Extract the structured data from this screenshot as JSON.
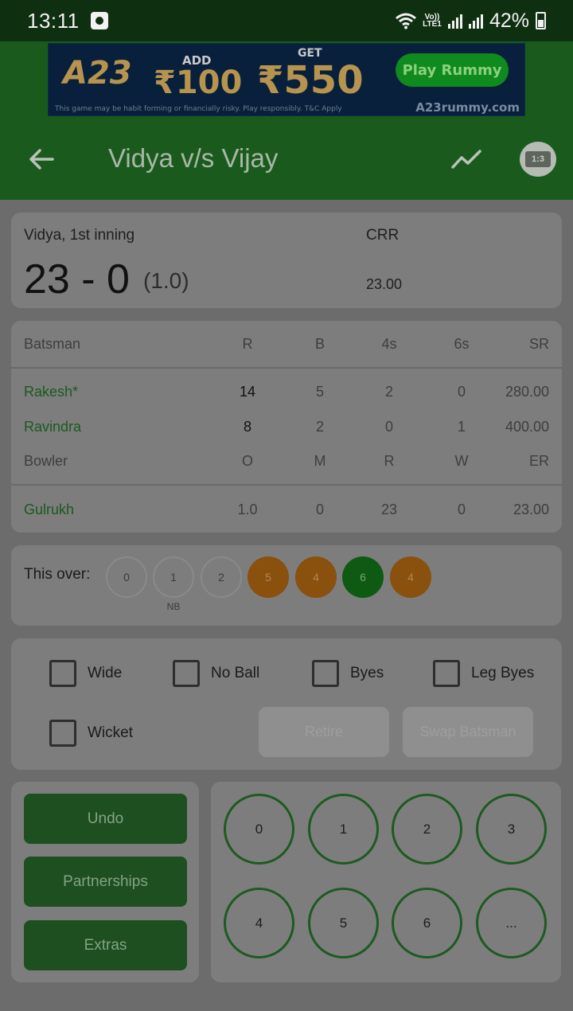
{
  "status_bar": {
    "time": "13:11",
    "network": "Vo)) LTE1",
    "battery": "42%"
  },
  "ad": {
    "logo": "A23",
    "add_label": "ADD",
    "add_value": "₹100",
    "get_label": "GET",
    "get_value": "₹550",
    "cta": "Play Rummy",
    "disclaimer": "This game may be habit forming or financially risky. Play responsibly. T&C Apply",
    "site": "A23rummy.com"
  },
  "header": {
    "title": "Vidya v/s Vijay",
    "scoreboard_icon_text": "1:3"
  },
  "score": {
    "inning": "Vidya, 1st inning",
    "runs_wickets": "23 - 0",
    "overs": "(1.0)",
    "crr_label": "CRR",
    "crr_value": "23.00"
  },
  "batting": {
    "headers": [
      "Batsman",
      "R",
      "B",
      "4s",
      "6s",
      "SR"
    ],
    "rows": [
      [
        "Rakesh*",
        "14",
        "5",
        "2",
        "0",
        "280.00"
      ],
      [
        "Ravindra",
        "8",
        "2",
        "0",
        "1",
        "400.00"
      ]
    ]
  },
  "bowling": {
    "headers": [
      "Bowler",
      "O",
      "M",
      "R",
      "W",
      "ER"
    ],
    "rows": [
      [
        "Gulrukh",
        "1.0",
        "0",
        "23",
        "0",
        "23.00"
      ]
    ]
  },
  "this_over": {
    "label": "This over:",
    "balls": [
      {
        "value": "0",
        "style": "plain",
        "note": ""
      },
      {
        "value": "1",
        "style": "plain",
        "note": "NB"
      },
      {
        "value": "2",
        "style": "plain",
        "note": ""
      },
      {
        "value": "5",
        "style": "orange",
        "note": ""
      },
      {
        "value": "4",
        "style": "orange",
        "note": ""
      },
      {
        "value": "6",
        "style": "green",
        "note": ""
      },
      {
        "value": "4",
        "style": "orange",
        "note": ""
      }
    ]
  },
  "extras": {
    "wide": "Wide",
    "no_ball": "No Ball",
    "byes": "Byes",
    "leg_byes": "Leg Byes",
    "wicket": "Wicket",
    "retire": "Retire",
    "swap": "Swap Batsman"
  },
  "actions": {
    "undo": "Undo",
    "partnerships": "Partnerships",
    "extras": "Extras"
  },
  "runs": [
    "0",
    "1",
    "2",
    "3",
    "4",
    "5",
    "6",
    "..."
  ]
}
